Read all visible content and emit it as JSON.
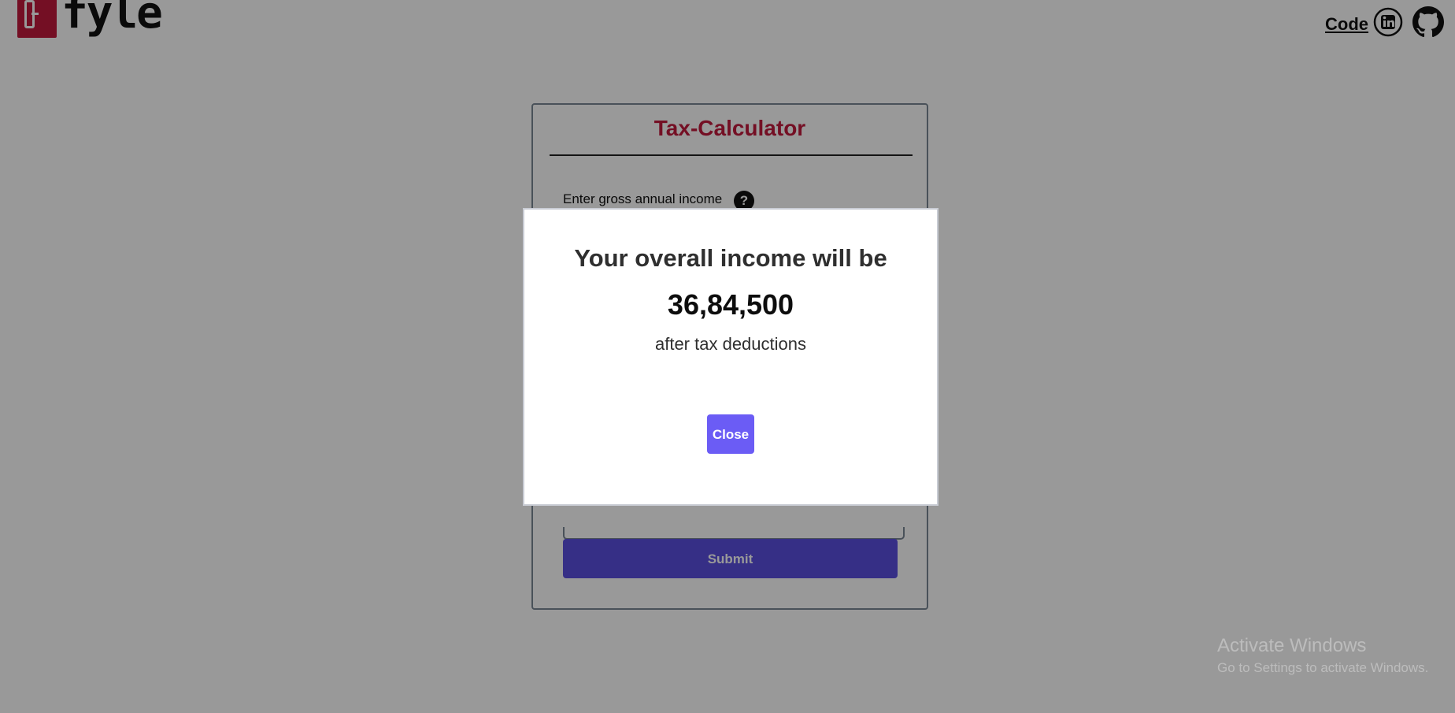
{
  "header": {
    "logo_text": "fyle",
    "code_link": "Code",
    "icons": [
      "linkedin-icon",
      "github-icon"
    ]
  },
  "card": {
    "title": "Tax-Calculator",
    "field_label": "Enter gross annual income",
    "help_icon": "?",
    "submit_label": "Submit"
  },
  "modal": {
    "heading": "Your overall income will be",
    "amount": "36,84,500",
    "subtext": "after tax deductions",
    "close_label": "Close"
  },
  "watermark": {
    "title": "Activate Windows",
    "subtitle": "Go to Settings to activate Windows."
  },
  "colors": {
    "brand": "#c2193d",
    "accent": "#6b5cf5",
    "submit": "#5a4fe0"
  }
}
